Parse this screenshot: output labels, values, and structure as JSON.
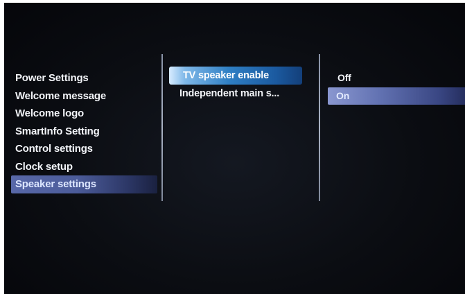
{
  "menus": {
    "left": {
      "items": [
        {
          "label": "Power Settings"
        },
        {
          "label": "Welcome message"
        },
        {
          "label": "Welcome logo"
        },
        {
          "label": "SmartInfo Setting"
        },
        {
          "label": "Control settings"
        },
        {
          "label": "Clock setup"
        },
        {
          "label": "Speaker settings"
        }
      ],
      "selected_index": 6
    },
    "middle": {
      "items": [
        {
          "label": "TV speaker enable"
        },
        {
          "label": "Independent main s..."
        }
      ],
      "selected_index": 0
    },
    "right": {
      "items": [
        {
          "label": "Off"
        },
        {
          "label": "On"
        }
      ],
      "selected_index": 1
    }
  },
  "colors": {
    "background": "#0b0d12",
    "text": "#f2f4f8",
    "highlight_left": "#4c5c9a",
    "highlight_middle": "#2f7fc4",
    "highlight_right": "#6272b2",
    "divider": "#aab3c4"
  }
}
